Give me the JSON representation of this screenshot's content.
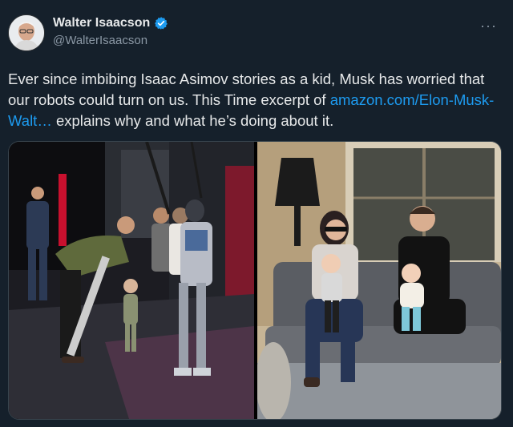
{
  "author": {
    "name": "Walter Isaacson",
    "handle": "@WalterIsaacson",
    "verified": true
  },
  "tweet": {
    "text_before_link": "Ever since imbibing Isaac Asimov stories as a kid, Musk has worried that our robots could turn on us.  This Time excerpt of ",
    "link_text": "amazon.com/Elon-Musk-Walt…",
    "text_after_link": " explains why and what he’s doing about it."
  },
  "icons": {
    "verified": "verified-badge-icon",
    "more": "more-options-icon"
  },
  "media": {
    "count": 2,
    "photos": [
      "robot-lab-photo",
      "family-couch-photo"
    ]
  },
  "colors": {
    "background": "#15202b",
    "text": "#e7e9ea",
    "secondary": "#8b98a5",
    "link": "#1d9bf0",
    "verified": "#1d9bf0"
  }
}
